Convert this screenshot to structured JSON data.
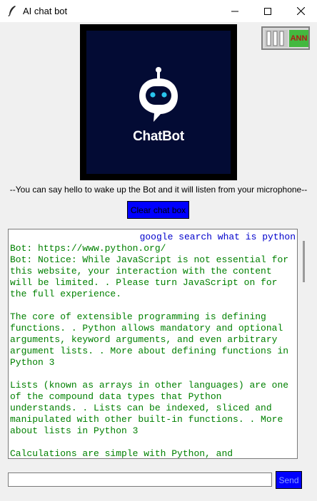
{
  "window": {
    "title": "AI chat bot",
    "app_icon": "feather-icon"
  },
  "logo": {
    "text": "ChatBot",
    "icon": "robot-icon",
    "background_color": "#030b34"
  },
  "toggle": {
    "label": "ANN",
    "state": "on"
  },
  "info_text": "--You can say hello to wake up the Bot and it will listen from your microphone--",
  "clear_button": {
    "label": "Clear chat box"
  },
  "chat": {
    "user_message": "google search what is python",
    "bot_lines": [
      "Bot: https://www.python.org/",
      "Bot: Notice: While JavaScript is not essential for\nthis website, your interaction with the content\nwill be limited. . Please turn JavaScript on for\nthe full experience.\n\nThe core of extensible programming is defining\nfunctions. . Python allows mandatory and optional\narguments, keyword arguments, and even arbitrary\nargument lists. . More about defining functions in\nPython 3\n\nLists (known as arrays in other languages) are one\nof the compound data types that Python\nunderstands. . Lists can be indexed, sliced and\nmanipulated with other built-in functions. . More\nabout lists in Python 3\n\nCalculations are simple with Python, and"
    ],
    "user_color": "#0000cc",
    "bot_color": "#008000"
  },
  "input": {
    "value": "",
    "placeholder": ""
  },
  "send_button": {
    "label": "Send"
  },
  "colors": {
    "button_blue": "#0000ff",
    "toggle_green": "#43b83f",
    "toggle_label_red": "#b01818"
  }
}
